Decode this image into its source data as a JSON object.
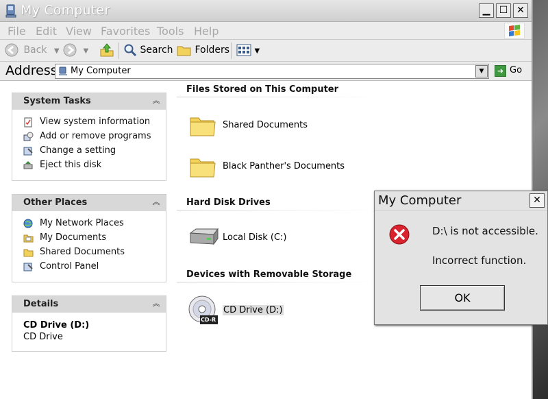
{
  "window": {
    "title": "My Computer"
  },
  "menubar": {
    "items": [
      "File",
      "Edit",
      "View",
      "Favorites",
      "Tools",
      "Help"
    ]
  },
  "toolbar": {
    "back_label": "Back",
    "search_label": "Search",
    "folders_label": "Folders"
  },
  "address": {
    "label": "Address",
    "value": "My Computer",
    "go_label": "Go"
  },
  "sidebar": {
    "system_tasks": {
      "title": "System Tasks",
      "items": [
        "View system information",
        "Add or remove programs",
        "Change a setting",
        "Eject this disk"
      ]
    },
    "other_places": {
      "title": "Other Places",
      "items": [
        "My Network Places",
        "My Documents",
        "Shared Documents",
        "Control Panel"
      ]
    },
    "details": {
      "title": "Details",
      "name": "CD Drive (D:)",
      "type": "CD Drive"
    }
  },
  "main": {
    "files_stored": {
      "title": "Files Stored on This Computer",
      "items": [
        "Shared Documents",
        "Black Panther's Documents"
      ]
    },
    "hard_disks": {
      "title": "Hard Disk Drives",
      "items": [
        "Local Disk (C:)"
      ]
    },
    "removable": {
      "title": "Devices with Removable Storage",
      "items": [
        "CD Drive (D:)"
      ],
      "cd_badge": "CD-R"
    }
  },
  "dialog": {
    "title": "My Computer",
    "message": "D:\\ is not accessible.",
    "detail": "Incorrect function.",
    "ok_label": "OK"
  }
}
